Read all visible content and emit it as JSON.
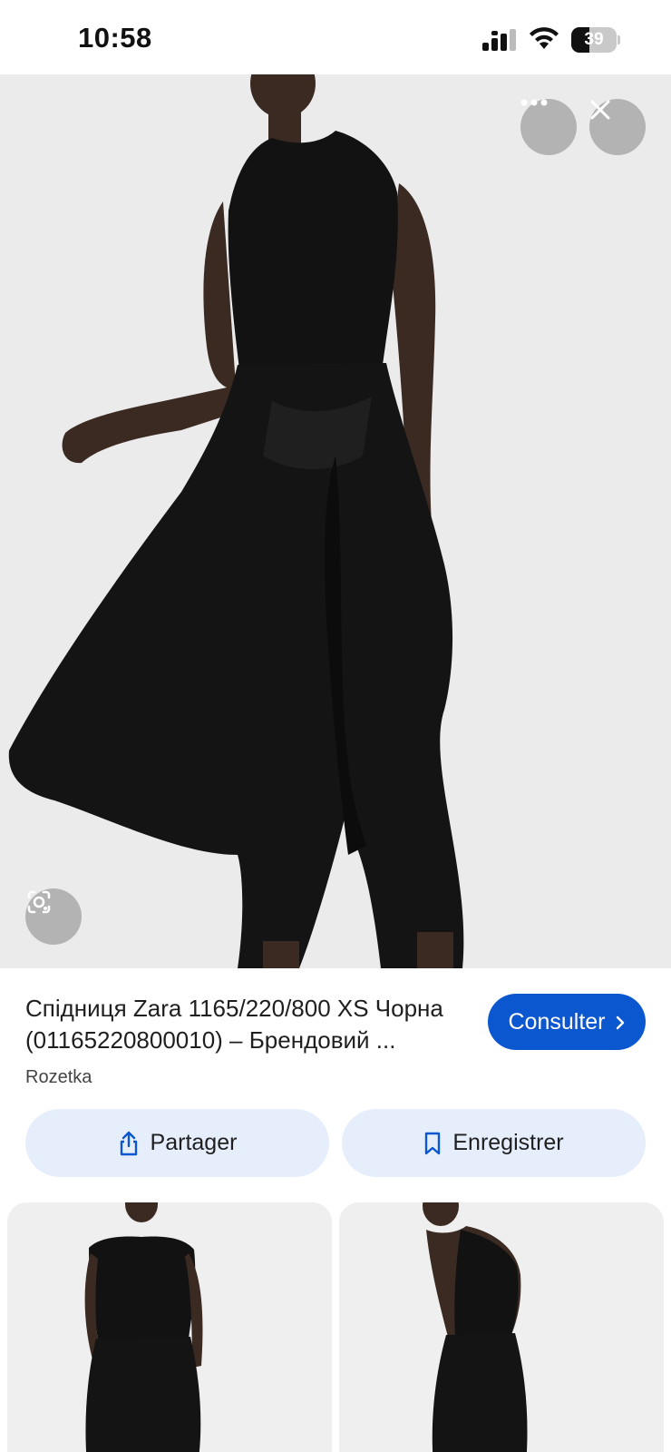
{
  "status_bar": {
    "time": "10:58",
    "battery_level": "39",
    "icons": [
      "cellular-signal-icon",
      "wifi-icon",
      "battery-icon"
    ]
  },
  "viewer": {
    "more_icon": "more-horizontal-icon",
    "close_icon": "close-icon",
    "lens_icon": "lens-search-icon"
  },
  "result": {
    "title": "Спідниця Zara 1165/220/800 XS Чорна (01165220800010) – Брендовий ...",
    "source": "Rozetka",
    "visit_label": "Consulter",
    "share_label": "Partager",
    "save_label": "Enregistrer"
  },
  "colors": {
    "accent": "#0b57d0",
    "chip_bg": "#e6eefc",
    "garment": "#111111"
  }
}
